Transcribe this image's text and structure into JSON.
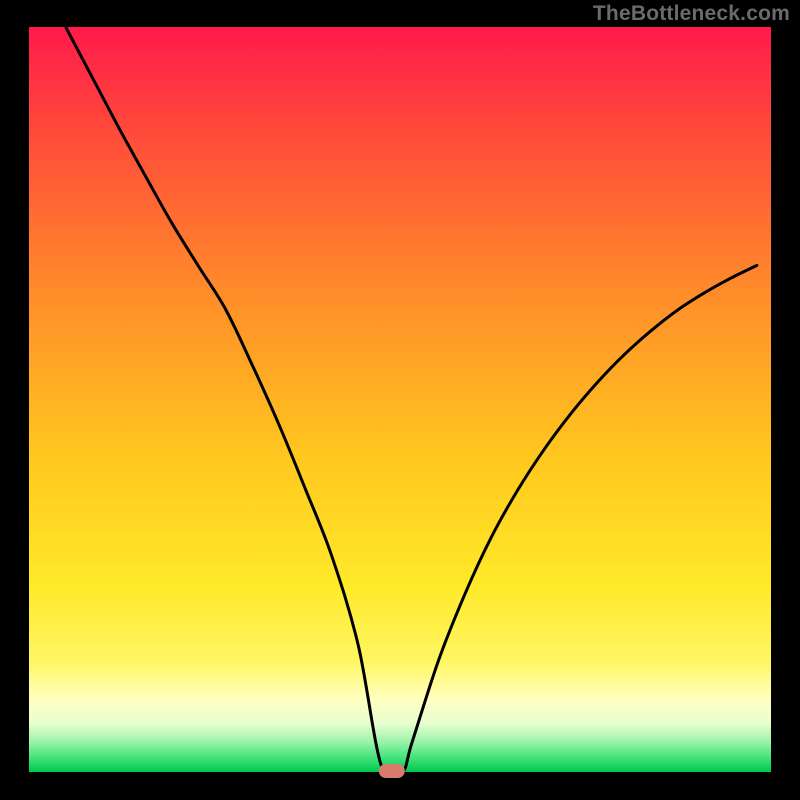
{
  "watermark": "TheBottleneck.com",
  "colors": {
    "black": "#000000",
    "curve": "#000000",
    "marker": "#d87a6d",
    "gradient_top": "#ff1a4b",
    "gradient_mid": "#ffd400",
    "gradient_band_light": "#ffffc2",
    "gradient_green_pale": "#bef7c4",
    "gradient_green": "#2fe66a",
    "gradient_green_deep": "#00c84e"
  },
  "chart_data": {
    "type": "line",
    "title": "",
    "xlabel": "",
    "ylabel": "",
    "xlim": [
      0,
      100
    ],
    "ylim": [
      0,
      100
    ],
    "note": "Approximate reading of a bottleneck V-curve with heatmap background (red=high bottleneck, green=low). Minimum around x≈47, value≈0.",
    "x": [
      5.0,
      8.6,
      12.2,
      15.8,
      19.3,
      22.9,
      26.5,
      30.1,
      33.7,
      37.2,
      40.8,
      44.4,
      47.5,
      50.3,
      51.6,
      55.2,
      58.8,
      62.3,
      65.9,
      69.5,
      73.1,
      76.7,
      80.2,
      83.8,
      87.4,
      91.0,
      94.6,
      98.1
    ],
    "values": [
      99.9,
      93.1,
      86.3,
      79.8,
      73.6,
      67.8,
      62.1,
      54.6,
      46.6,
      38.1,
      29.0,
      16.9,
      0.8,
      0.0,
      3.9,
      15.0,
      24.0,
      31.5,
      37.9,
      43.4,
      48.2,
      52.4,
      56.0,
      59.2,
      62.0,
      64.3,
      66.3,
      68.0
    ],
    "minimum": {
      "x": 48.9,
      "value": 0.0
    }
  }
}
